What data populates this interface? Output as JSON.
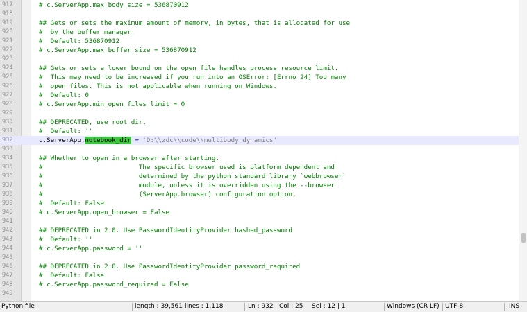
{
  "editor": {
    "lines": [
      {
        "num": "917",
        "text": "# c.ServerApp.max_body_size = 536870912",
        "kind": "comment"
      },
      {
        "num": "918",
        "text": "",
        "kind": "comment"
      },
      {
        "num": "919",
        "text": "## Gets or sets the maximum amount of memory, in bytes, that is allocated for use",
        "kind": "comment"
      },
      {
        "num": "920",
        "text": "#  by the buffer manager.",
        "kind": "comment"
      },
      {
        "num": "921",
        "text": "#  Default: 536870912",
        "kind": "comment"
      },
      {
        "num": "922",
        "text": "# c.ServerApp.max_buffer_size = 536870912",
        "kind": "comment"
      },
      {
        "num": "923",
        "text": "",
        "kind": "comment"
      },
      {
        "num": "924",
        "text": "## Gets or sets a lower bound on the open file handles process resource limit.",
        "kind": "comment"
      },
      {
        "num": "925",
        "text": "#  This may need to be increased if you run into an OSError: [Errno 24] Too many",
        "kind": "comment"
      },
      {
        "num": "926",
        "text": "#  open files. This is not applicable when running on Windows.",
        "kind": "comment"
      },
      {
        "num": "927",
        "text": "#  Default: 0",
        "kind": "comment"
      },
      {
        "num": "928",
        "text": "# c.ServerApp.min_open_files_limit = 0",
        "kind": "comment"
      },
      {
        "num": "929",
        "text": "",
        "kind": "comment"
      },
      {
        "num": "930",
        "text": "## DEPRECATED, use root_dir.",
        "kind": "comment"
      },
      {
        "num": "931",
        "text": "#  Default: ''",
        "kind": "comment"
      },
      {
        "num": "932",
        "text": "",
        "kind": "code",
        "current": true
      },
      {
        "num": "933",
        "text": "",
        "kind": "comment"
      },
      {
        "num": "934",
        "text": "## Whether to open in a browser after starting.",
        "kind": "comment"
      },
      {
        "num": "935",
        "text": "#                         The specific browser used is platform dependent and",
        "kind": "comment"
      },
      {
        "num": "936",
        "text": "#                         determined by the python standard library `webbrowser`",
        "kind": "comment"
      },
      {
        "num": "937",
        "text": "#                         module, unless it is overridden using the --browser",
        "kind": "comment"
      },
      {
        "num": "938",
        "text": "#                         (ServerApp.browser) configuration option.",
        "kind": "comment"
      },
      {
        "num": "939",
        "text": "#  Default: False",
        "kind": "comment"
      },
      {
        "num": "940",
        "text": "# c.ServerApp.open_browser = False",
        "kind": "comment"
      },
      {
        "num": "941",
        "text": "",
        "kind": "comment"
      },
      {
        "num": "942",
        "text": "## DEPRECATED in 2.0. Use PasswordIdentityProvider.hashed_password",
        "kind": "comment"
      },
      {
        "num": "943",
        "text": "#  Default: ''",
        "kind": "comment"
      },
      {
        "num": "944",
        "text": "# c.ServerApp.password = ''",
        "kind": "comment"
      },
      {
        "num": "945",
        "text": "",
        "kind": "comment"
      },
      {
        "num": "946",
        "text": "## DEPRECATED in 2.0. Use PasswordIdentityProvider.password_required",
        "kind": "comment"
      },
      {
        "num": "947",
        "text": "#  Default: False",
        "kind": "comment"
      },
      {
        "num": "948",
        "text": "# c.ServerApp.password_required = False",
        "kind": "comment"
      },
      {
        "num": "949",
        "text": "",
        "kind": "comment"
      }
    ],
    "current_line": {
      "obj": "c.ServerApp.",
      "highlight": "notebook_dir",
      "op": " = ",
      "value": "'D:\\\\zdc\\\\code\\\\multibody dynamics'"
    },
    "colors": {
      "comment": "#008000",
      "highlight": "#3cc83c",
      "current_line_bg": "#e8e8ff",
      "string": "#808080"
    }
  },
  "statusbar": {
    "file_type": "Python file",
    "length": "length : 39,561",
    "lines": "lines : 1,118",
    "ln": "Ln : 932",
    "col": "Col : 25",
    "sel": "Sel : 12 | 1",
    "eol": "Windows (CR LF)",
    "encoding": "UTF-8",
    "mode": "INS"
  }
}
